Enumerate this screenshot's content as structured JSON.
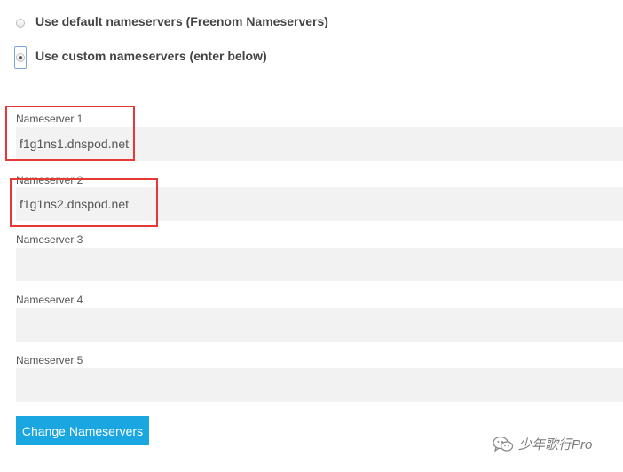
{
  "nameserver_options": [
    {
      "label": "Use default nameservers (Freenom Nameservers)",
      "checked": false
    },
    {
      "label": "Use custom nameservers (enter below)",
      "checked": true
    }
  ],
  "nameservers": [
    {
      "label": "Nameserver 1",
      "value": "f1g1ns1.dnspod.net",
      "highlighted": true
    },
    {
      "label": "Nameserver 2",
      "value": "f1g1ns2.dnspod.net",
      "highlighted": true
    },
    {
      "label": "Nameserver 3",
      "value": ""
    },
    {
      "label": "Nameserver 4",
      "value": ""
    },
    {
      "label": "Nameserver 5",
      "value": ""
    }
  ],
  "submit_button": {
    "label": "Change Nameservers",
    "color": "#1aa6e0"
  },
  "highlight_color": "#e53935",
  "watermark": {
    "text": "少年歌行Pro",
    "icon": "wechat-icon"
  }
}
